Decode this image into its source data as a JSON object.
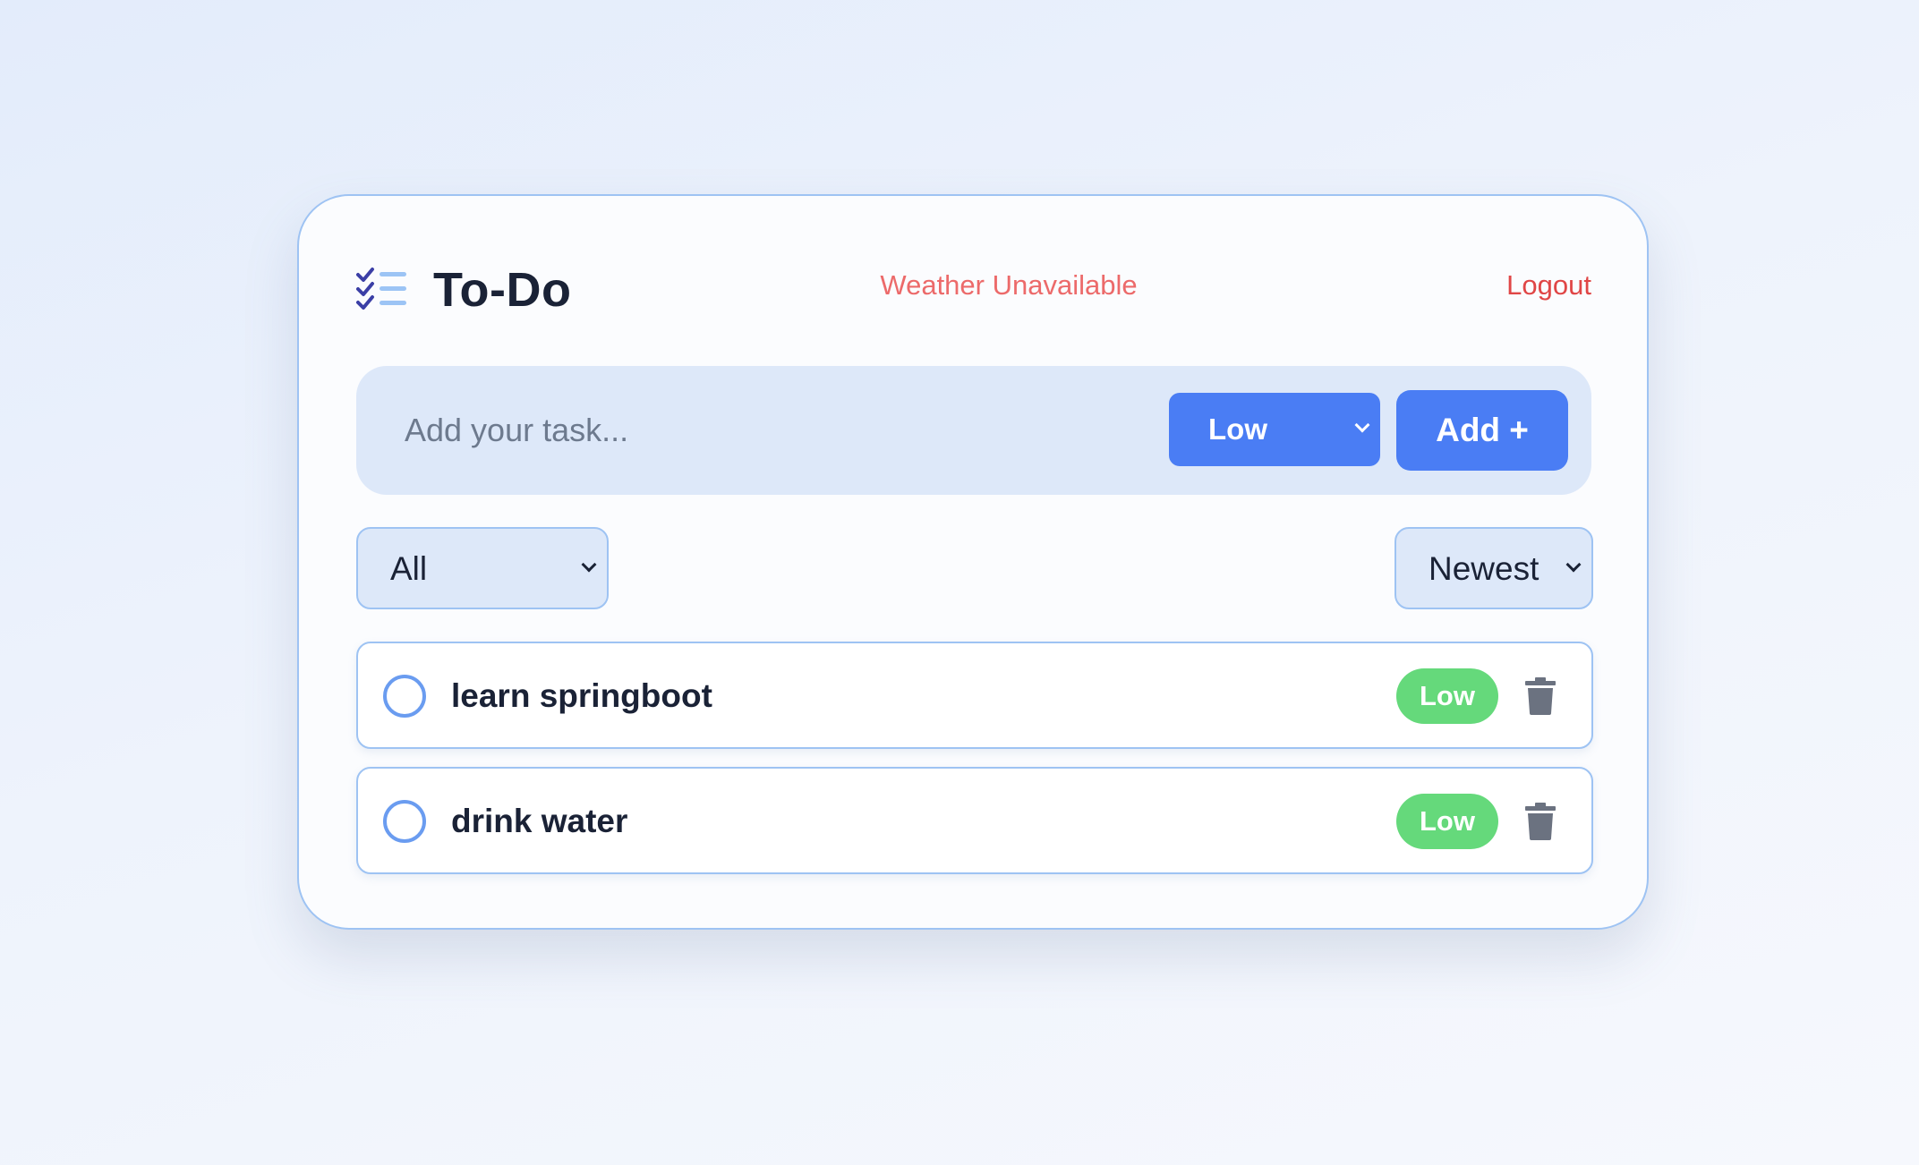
{
  "header": {
    "title": "To-Do",
    "weather": "Weather Unavailable",
    "logout_label": "Logout",
    "logo_icon": "checklist-icon"
  },
  "add_task": {
    "placeholder": "Add your task...",
    "priority_value": "Low",
    "add_label": "Add +"
  },
  "filters": {
    "status_value": "All",
    "sort_value": "Newest"
  },
  "tasks": [
    {
      "text": "learn springboot",
      "priority": "Low",
      "completed": false
    },
    {
      "text": "drink water",
      "priority": "Low",
      "completed": false
    }
  ],
  "colors": {
    "accent": "#4a7df4",
    "priority_low": "#65d97b",
    "logout": "#e04646",
    "weather": "#ec6a6a"
  }
}
